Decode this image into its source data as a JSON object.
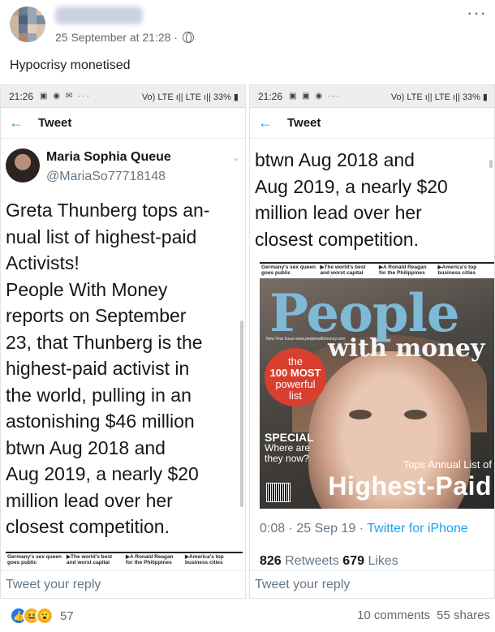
{
  "post": {
    "timestamp": "25 September at 21:28 ·",
    "caption": "Hypocrisy monetised",
    "reaction_count": "57",
    "comments": "10 comments",
    "shares": "55 shares"
  },
  "left_shot": {
    "time": "21:26",
    "status_icons": "▣ ◉ ✉ ···",
    "status_right": "Vo) LTE ı|| LTE ı|| 33% ▮",
    "nav_title": "Tweet",
    "user_name": "Maria Sophia Queue",
    "user_handle": "@MariaSo77718148",
    "tweet_text": "Greta Thunberg tops an-\nnual list of highest-paid\nActivists!\nPeople With Money\nreports on September\n23, that Thunberg is the\nhighest-paid activist in\nthe world, pulling in an\nastonishing $46 million\nbtwn Aug 2018 and\nAug 2019, a nearly $20\nmillion lead over her\nclosest competition.",
    "reply_placeholder": "Tweet your reply"
  },
  "right_shot": {
    "time": "21:26",
    "status_icons": "▣ ▣ ◉ ···",
    "status_right": "Vo) LTE ı|| LTE ı|| 33% ▮",
    "nav_title": "Tweet",
    "tweet_text": "btwn Aug 2018 and\nAug 2019, a nearly $20\nmillion lead over her\nclosest competition.",
    "tweet_meta_time": "0:08 · 25 Sep 19 · ",
    "tweet_meta_via": "Twitter for iPhone",
    "retweets_count": "826",
    "retweets_label": " Retweets  ",
    "likes_count": "679",
    "likes_label": " Likes",
    "reply_placeholder": "Tweet your reply"
  },
  "magazine_strip": {
    "items": [
      "Germany's sex queen goes public",
      "▶The world's best and worst capital markets",
      "▶A Ronald Reagan for the Philippines",
      "▶America's top business cities"
    ]
  },
  "magazine": {
    "title": "People",
    "subtitle": "with money",
    "tiny_text": "New Year Issue www.peoplewithmoney.com",
    "badge_line1": "the",
    "badge_line2": "100 MOST",
    "badge_line3": "powerful",
    "badge_line4": "list",
    "special_1": "SPECIAL",
    "special_2": "Where are",
    "special_3": "they now?",
    "tops": "Tops Annual List of",
    "highest_paid": "Highest-Paid"
  },
  "icons": {
    "globe": "globe-icon",
    "back": "arrow-left-icon",
    "more": "more-horizontal-icon",
    "like": "like-icon",
    "haha": "haha-icon",
    "wow": "wow-icon"
  }
}
